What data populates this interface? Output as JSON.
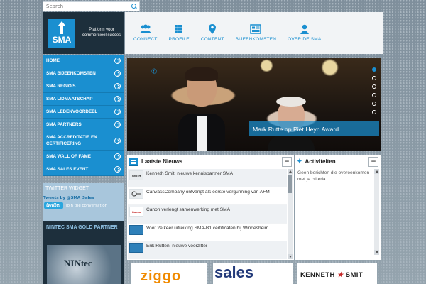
{
  "search": {
    "placeholder": "Search"
  },
  "brand": {
    "logo_text": "SMA",
    "tagline": "Platform voor commercieel succes"
  },
  "topnav": [
    {
      "label": "CONNECT",
      "icon": "people-icon"
    },
    {
      "label": "PROFILE",
      "icon": "calendar-grid-icon"
    },
    {
      "label": "CONTENT",
      "icon": "map-pin-icon"
    },
    {
      "label": "BIJEENKOMSTEN",
      "icon": "news-icon"
    },
    {
      "label": "OVER DE SMA",
      "icon": "person-icon"
    }
  ],
  "menu": [
    {
      "label": "HOME"
    },
    {
      "label": "SMA BIJEENKOMSTEN"
    },
    {
      "label": "SMA REGIO'S"
    },
    {
      "label": "SMA LIDMAATSCHAP"
    },
    {
      "label": "SMA LEDENVOORDEEL"
    },
    {
      "label": "SMA PARTNERS"
    },
    {
      "label": "SMA ACCREDITATIE EN CERTIFICERING"
    },
    {
      "label": "SMA WALL OF FAME"
    },
    {
      "label": "SMA SALES EVENT"
    }
  ],
  "twitter": {
    "title": "TWITTER WIDGET",
    "handle": "Tweets by @SMA_Sales",
    "logo": "twitter",
    "join": "Join the conversation"
  },
  "partner": {
    "title": "NINTEC SMA GOLD PARTNER",
    "logo": "NINtec"
  },
  "slider": {
    "caption": "Mark Rutte op Piet Heyn Award",
    "active_index": 0,
    "slide_count": 6
  },
  "news": {
    "title": "Laatste Nieuws",
    "items": [
      {
        "thumb": "SMITH",
        "text": "Kenneth Smit, nieuwe kennispartner SMA"
      },
      {
        "thumb": "",
        "text": "CanvassCompany ontvangt als eerste vergunning van AFM"
      },
      {
        "thumb": "Canon",
        "text": "Canon verlengt samenwerking met SMA"
      },
      {
        "thumb": "",
        "text": "Voor 2e keer uitreiking SMA-B1 certificaten bij Windesheim"
      },
      {
        "thumb": "",
        "text": "Erik Rutten, nieuwe voorzitter"
      }
    ]
  },
  "activities": {
    "title": "Activiteiten",
    "empty_text": "Geen berichten die overeenkomen met je criteria."
  },
  "sponsors": {
    "ziggo": "ziggo",
    "sales": "sales",
    "kenneth_a": "KENNETH",
    "kenneth_b": "SMIT"
  },
  "colors": {
    "accent": "#1a8fd0",
    "dark": "#1d2f3c"
  }
}
